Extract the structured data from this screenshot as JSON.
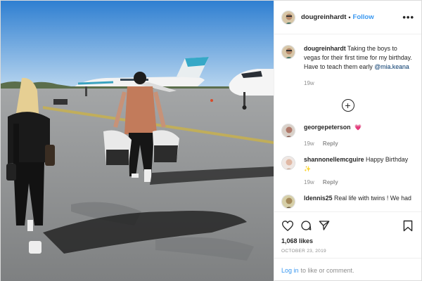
{
  "post": {
    "username": "dougreinhardt",
    "follow_label": "Follow",
    "header_separator": "•",
    "more_label": "•••"
  },
  "caption": {
    "username": "dougreinhardt",
    "text": "Taking the boys to vegas for their first time for my birthday. Have to teach them early",
    "mention": "@mia.keana",
    "time": "19w"
  },
  "load_more_label": "+",
  "comments": [
    {
      "username": "georgepeterson",
      "text": "",
      "time": "19w",
      "reply": "Reply"
    },
    {
      "username": "shannonellemcguire",
      "text": "Happy Birthday",
      "time": "19w",
      "reply": "Reply"
    },
    {
      "username": "ldennis25",
      "text": "Real life with twins ! We had",
      "time": "",
      "reply": ""
    }
  ],
  "likes": "1,068 likes",
  "date": "OCTOBER 23, 2019",
  "login": {
    "link": "Log in",
    "text": "to like or comment."
  },
  "icons": [
    "heart-icon",
    "comment-icon",
    "share-icon",
    "bookmark-icon",
    "add-icon"
  ],
  "colors": {
    "link": "#3897f0",
    "secondary": "#8e8e8e",
    "text": "#262626",
    "sky": "#4f95d6",
    "tarmac": "#8d8f90"
  }
}
